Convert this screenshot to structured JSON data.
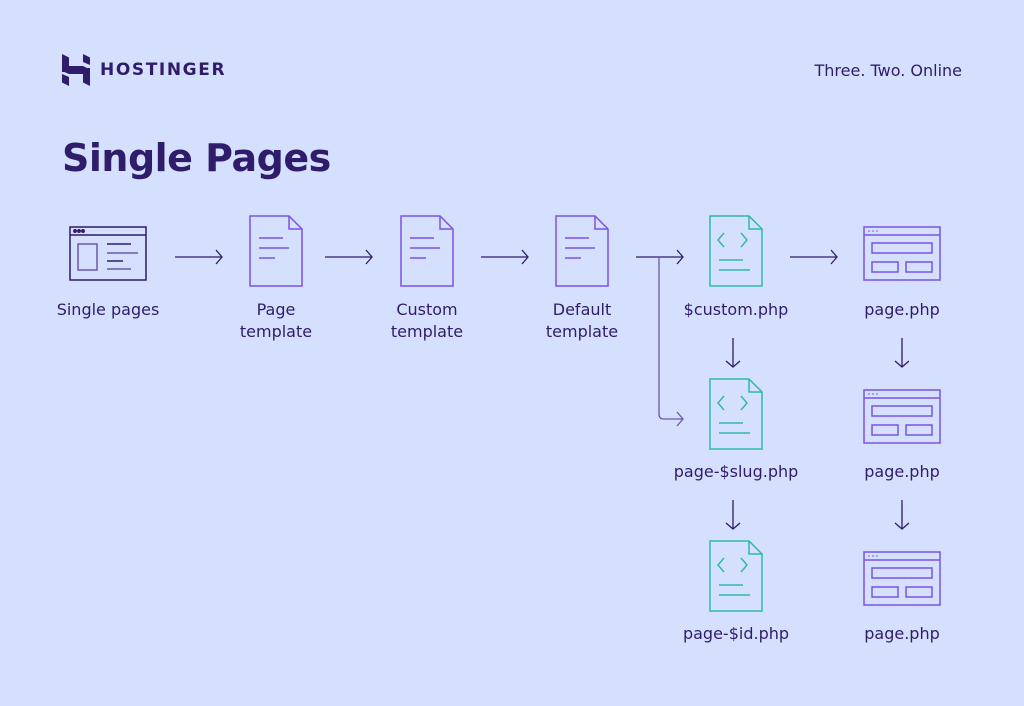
{
  "brand": {
    "name": "HOSTINGER",
    "tagline": "Three. Two. Online"
  },
  "title": "Single Pages",
  "colors": {
    "background": "#d5dffe",
    "text": "#2f1c6a",
    "template_icon": "#7b52e6",
    "php_icon": "#2fb9ab",
    "arrow": "#2f1c6a"
  },
  "nodes": [
    {
      "id": "single-pages",
      "label_lines": [
        "Single pages"
      ],
      "icon": "browser-layout-icon"
    },
    {
      "id": "page-template",
      "label_lines": [
        "Page",
        "template"
      ],
      "icon": "document-icon"
    },
    {
      "id": "custom-template",
      "label_lines": [
        "Custom",
        "template"
      ],
      "icon": "document-icon"
    },
    {
      "id": "default-template",
      "label_lines": [
        "Default",
        "template"
      ],
      "icon": "document-icon"
    },
    {
      "id": "custom-php",
      "label_lines": [
        "$custom.php"
      ],
      "icon": "code-file-icon"
    },
    {
      "id": "page-slug-php",
      "label_lines": [
        "page-$slug.php"
      ],
      "icon": "code-file-icon"
    },
    {
      "id": "page-id-php",
      "label_lines": [
        "page-$id.php"
      ],
      "icon": "code-file-icon"
    },
    {
      "id": "page-php-1",
      "label_lines": [
        "page.php"
      ],
      "icon": "browser-wireframe-icon"
    },
    {
      "id": "page-php-2",
      "label_lines": [
        "page.php"
      ],
      "icon": "browser-wireframe-icon"
    },
    {
      "id": "page-php-3",
      "label_lines": [
        "page.php"
      ],
      "icon": "browser-wireframe-icon"
    }
  ],
  "edges": [
    {
      "from": "single-pages",
      "to": "page-template"
    },
    {
      "from": "page-template",
      "to": "custom-template"
    },
    {
      "from": "custom-template",
      "to": "default-template"
    },
    {
      "from": "default-template",
      "to": "custom-php"
    },
    {
      "from": "default-template",
      "to": "page-slug-php"
    },
    {
      "from": "custom-php",
      "to": "page-php-1"
    },
    {
      "from": "custom-php",
      "to": "page-slug-php"
    },
    {
      "from": "page-slug-php",
      "to": "page-id-php"
    },
    {
      "from": "page-php-1",
      "to": "page-php-2"
    },
    {
      "from": "page-php-2",
      "to": "page-php-3"
    }
  ]
}
